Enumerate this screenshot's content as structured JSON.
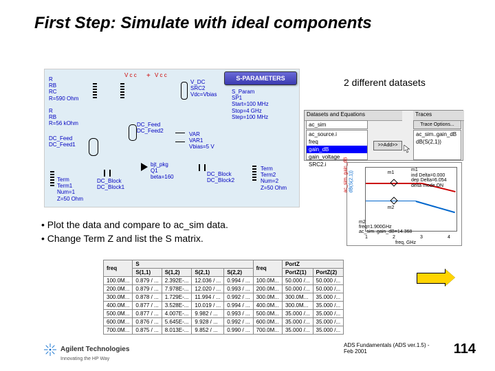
{
  "title": "First Step: Simulate with ideal components",
  "schematic": {
    "r_rc": "R\nRB\nRC\nR=590 Ohm",
    "r_56k": "R\nRB\nR=56 kOhm",
    "dc_feed1": "DC_Feed\nDC_Feed1",
    "dc_feed2": "DC_Feed\nDC_Feed2",
    "vdc": "V_DC\nSRC2\nVdc=Vbias",
    "sparam": "S_Param\nSP1\nStart=100 MHz\nStop=4 GHz\nStep=100 MHz",
    "var": "VAR\nVAR1\nVbias=5 V",
    "bjt": "bjt_pkg\nQ1\nbeta=160",
    "dc_block1": "DC_Block\nDC_Block1",
    "dc_block2": "DC_Block\nDC_Block2",
    "term1": "Term\nTerm1\nNum=1\nZ=50 Ohm",
    "term2": "Term\nTerm2\nNum=2\nZ=50 Ohm",
    "sp_badge": "S-PARAMETERS",
    "vcc1": "V c c",
    "vcc2": "V c c",
    "plus": "+",
    "minus": "−"
  },
  "datasets_label": "2 different datasets",
  "ds_panel": {
    "h_left": "Datasets and Equations",
    "h_right": "Traces",
    "btn_trace": "Trace Options...",
    "list_left_top": "ac_sim",
    "list_mid": [
      "ac_source.i",
      "freq",
      "gain_dB",
      "gain_voltage",
      "SRC2.i"
    ],
    "list_right": [
      "ac_sim..gain_dB",
      "dB(S(2,1))"
    ],
    "addbtn": ">>Add>>"
  },
  "chart_data": {
    "type": "line",
    "x": [
      1,
      2,
      3,
      4
    ],
    "series": [
      {
        "name": "ac_sim..gain_dB",
        "values": [
          22,
          22,
          21,
          15
        ],
        "color": "#c00"
      },
      {
        "name": "dB(S(2,1))",
        "values": [
          14.4,
          14.3,
          13,
          9
        ],
        "color": "#06c"
      }
    ],
    "xlabel": "freq, GHz",
    "ylabel_left": "ac_sim..gain_dB",
    "ylabel_right": "dB(S(2,1))",
    "ylim": [
      0,
      30
    ],
    "markers": [
      {
        "name": "m1",
        "x": 1.9,
        "y": 22
      },
      {
        "name": "m2",
        "x": 1.9,
        "y": 14.368
      }
    ],
    "annotation": "m1\nind Delta=0.000\ndep Delta=6.054\ndelta mode ON",
    "marker2_text": "m2\nfreq=1.900GHz\nac_sim..gain_dB=14.368",
    "xticks": [
      "1",
      "2",
      "3",
      "4"
    ],
    "yticks": [
      "0",
      "10",
      "20",
      "30"
    ]
  },
  "bullets": {
    "b1": "• Plot the data and compare to ac_sim data.",
    "b2": "• Change Term Z and list the S matrix."
  },
  "table": {
    "headers": [
      "freq",
      "S(1,1)",
      "S(1,2)",
      "S(2,1)",
      "S(2,2)",
      "freq",
      "PortZ(1)",
      "PortZ(2)"
    ],
    "group_s": "S",
    "group_pz": "PortZ",
    "rows": [
      [
        "100.0M...",
        "0.879 / ...",
        "2.392E-...",
        "12.036 / ...",
        "0.994 / ...",
        "100.0M...",
        "50.000 /...",
        "50.000 /..."
      ],
      [
        "200.0M...",
        "0.879 / ...",
        "7.978E-...",
        "12.020 / ...",
        "0.993 / ...",
        "200.0M...",
        "50.000 /...",
        "50.000 /..."
      ],
      [
        "300.0M...",
        "0.878 / ...",
        "1.729E-...",
        "11.994 / ...",
        "0.992 / ...",
        "300.0M...",
        "300.0M...",
        "35.000 /..."
      ],
      [
        "400.0M...",
        "0.877 / ...",
        "3.528E-...",
        "10.019 / ...",
        "0.994 / ...",
        "400.0M...",
        "300.0M...",
        "35.000 /..."
      ],
      [
        "500.0M...",
        "0.877 / ...",
        "4.007E-...",
        "9.982 / ...",
        "0.993 / ...",
        "500.0M...",
        "35.000 /...",
        "35.000 /..."
      ],
      [
        "600.0M...",
        "0.876 / ...",
        "5.645E-...",
        "9.928 / ...",
        "0.992 / ...",
        "600.0M...",
        "35.000 /...",
        "35.000 /..."
      ],
      [
        "700.0M...",
        "0.875 / ...",
        "8.013E-...",
        "9.852 / ...",
        "0.990 / ...",
        "700.0M...",
        "35.000 /...",
        "35.000 /..."
      ]
    ]
  },
  "logo": {
    "name": "Agilent Technologies",
    "sub": "Innovating the HP Way"
  },
  "footer": "ADS Fundamentals (ADS ver.1.5) - Feb 2001",
  "pagenum": "114"
}
